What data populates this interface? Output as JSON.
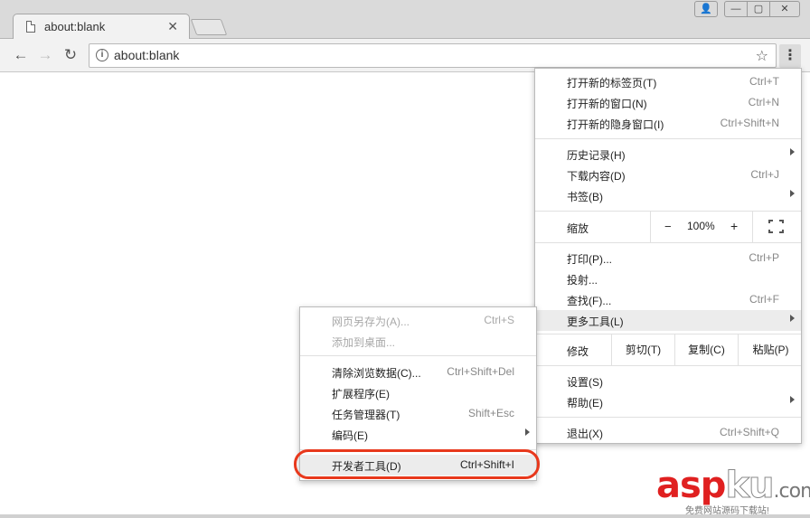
{
  "tab": {
    "title": "about:blank",
    "close": "✕"
  },
  "window_controls": {
    "user": "👤",
    "minimize": "—",
    "maximize": "▢",
    "close": "✕"
  },
  "toolbar": {
    "url": "about:blank",
    "back": "←",
    "forward": "→",
    "reload": "↻",
    "star": "☆",
    "menu": "⋮",
    "info": "i"
  },
  "main_menu": {
    "new_tab": {
      "label": "打开新的标签页(T)",
      "shortcut": "Ctrl+T"
    },
    "new_window": {
      "label": "打开新的窗口(N)",
      "shortcut": "Ctrl+N"
    },
    "incognito": {
      "label": "打开新的隐身窗口(I)",
      "shortcut": "Ctrl+Shift+N"
    },
    "history": {
      "label": "历史记录(H)"
    },
    "downloads": {
      "label": "下载内容(D)",
      "shortcut": "Ctrl+J"
    },
    "bookmarks": {
      "label": "书签(B)"
    },
    "zoom": {
      "label": "缩放",
      "minus": "−",
      "value": "100%",
      "plus": "+"
    },
    "print": {
      "label": "打印(P)...",
      "shortcut": "Ctrl+P"
    },
    "cast": {
      "label": "投射..."
    },
    "find": {
      "label": "查找(F)...",
      "shortcut": "Ctrl+F"
    },
    "more_tools": {
      "label": "更多工具(L)"
    },
    "edit": {
      "label": "修改",
      "cut": "剪切(T)",
      "copy": "复制(C)",
      "paste": "粘贴(P)"
    },
    "settings": {
      "label": "设置(S)"
    },
    "help": {
      "label": "帮助(E)"
    },
    "exit": {
      "label": "退出(X)",
      "shortcut": "Ctrl+Shift+Q"
    }
  },
  "sub_menu": {
    "save_page": {
      "label": "网页另存为(A)...",
      "shortcut": "Ctrl+S"
    },
    "add_desktop": {
      "label": "添加到桌面..."
    },
    "clear_data": {
      "label": "清除浏览数据(C)...",
      "shortcut": "Ctrl+Shift+Del"
    },
    "extensions": {
      "label": "扩展程序(E)"
    },
    "task_manager": {
      "label": "任务管理器(T)",
      "shortcut": "Shift+Esc"
    },
    "encoding": {
      "label": "编码(E)"
    },
    "dev_tools": {
      "label": "开发者工具(D)",
      "shortcut": "Ctrl+Shift+I"
    }
  },
  "watermark": {
    "asp": "asp",
    "ku": "ku",
    "com": ".com",
    "sub": "免费网站源码下载站!"
  },
  "colors": {
    "highlight": "#e8381c",
    "watermark": "#e02020"
  }
}
